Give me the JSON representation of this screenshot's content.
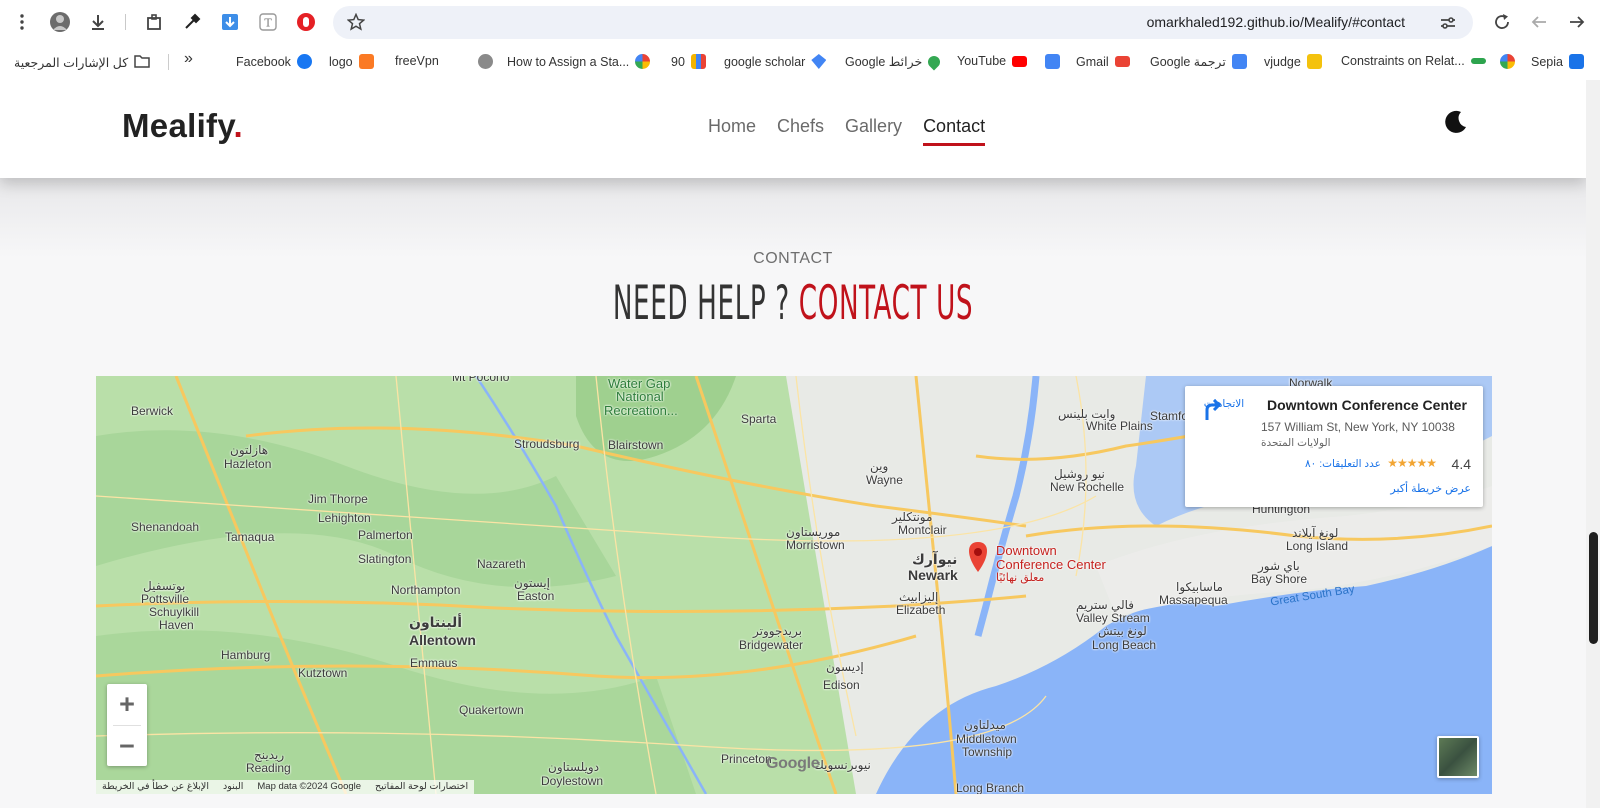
{
  "browser": {
    "url": "omarkhaled192.github.io/Mealify/#contact",
    "bookmarks": [
      {
        "label": "Facebook",
        "icon": "facebook-icon",
        "color": "#1877f2"
      },
      {
        "label": "logo",
        "icon": "xampp-icon",
        "color": "#fb7a24"
      },
      {
        "label": "freeVpn",
        "icon": "",
        "color": ""
      },
      {
        "label": "How to Assign a Sta...",
        "icon": "google-icon",
        "color": "#4285f4"
      },
      {
        "label": "90",
        "icon": "bar-chart-icon",
        "color": "#f4b400"
      },
      {
        "label": "google scholar",
        "icon": "scholar-icon",
        "color": "#4285f4"
      },
      {
        "label": "Google خرائط",
        "icon": "maps-icon",
        "color": "#34a853"
      },
      {
        "label": "YouTube",
        "icon": "youtube-icon",
        "color": "#ff0000"
      },
      {
        "label": "Gmail",
        "icon": "gmail-icon",
        "color": "#ea4335"
      },
      {
        "label": "Google ترجمة",
        "icon": "translate-icon",
        "color": "#4285f4"
      },
      {
        "label": "vjudge",
        "icon": "vjudge-icon",
        "color": "#f4c20d"
      },
      {
        "label": "Constraints on Relat...",
        "icon": "link-icon",
        "color": "#2da44e"
      },
      {
        "label": "Sepia",
        "icon": "code-icon",
        "color": "#1a73e8"
      }
    ],
    "all_bookmarks": "كل الإشارات المرجعية",
    "overflow": "»"
  },
  "site": {
    "logo": "Mealify",
    "logo_dot": ".",
    "nav": [
      "Home",
      "Chefs",
      "Gallery",
      "Contact"
    ],
    "active_nav": "Contact",
    "accent_color": "#c0121b"
  },
  "section": {
    "subtitle": "CONTACT",
    "title_plain": "NEED HELP ? ",
    "title_accent": "CONTACT US"
  },
  "map": {
    "place_name": "Downtown Conference Center",
    "address": "157 William St, New York, NY 10038",
    "country": "الولايات المتحدة",
    "directions_label": "الاتجاهات",
    "rating": "4.4",
    "stars": "★★★★★",
    "reviews": "عدد التعليقات: ٨٠",
    "larger_map": "عرض خريطة أكبر",
    "pin_label": "Downtown Conference Center",
    "pin_sublabel": "معلق نهائيًا",
    "zoom_in": "+",
    "zoom_out": "−",
    "google_logo": "Google",
    "attribution": [
      "الإبلاغ عن خطأ في الخريطة",
      "البنود",
      "Map data ©2024 Google",
      "اختصارات لوحة المفاتيح"
    ],
    "places": [
      {
        "name": "Berwick",
        "cls": ""
      },
      {
        "name": "هازلتون",
        "cls": ""
      },
      {
        "name": "Hazleton",
        "cls": ""
      },
      {
        "name": "Jim Thorpe",
        "cls": ""
      },
      {
        "name": "Lehighton",
        "cls": ""
      },
      {
        "name": "Shenandoah",
        "cls": ""
      },
      {
        "name": "Tamaqua",
        "cls": ""
      },
      {
        "name": "Palmerton",
        "cls": ""
      },
      {
        "name": "Slatington",
        "cls": ""
      },
      {
        "name": "Stroudsburg",
        "cls": ""
      },
      {
        "name": "Blairstown",
        "cls": ""
      },
      {
        "name": "Sparta",
        "cls": ""
      },
      {
        "name": "Mt Pocono",
        "cls": ""
      },
      {
        "name": "Water Gap",
        "cls": "green"
      },
      {
        "name": "National",
        "cls": "green"
      },
      {
        "name": "Recreation...",
        "cls": "green"
      },
      {
        "name": "Nazareth",
        "cls": ""
      },
      {
        "name": "Northampton",
        "cls": ""
      },
      {
        "name": "Easton",
        "cls": ""
      },
      {
        "name": "إيستون",
        "cls": ""
      },
      {
        "name": "بوتسفيل",
        "cls": ""
      },
      {
        "name": "Pottsville",
        "cls": ""
      },
      {
        "name": "Schuylkill",
        "cls": ""
      },
      {
        "name": "Haven",
        "cls": ""
      },
      {
        "name": "ألينتاون",
        "cls": "big"
      },
      {
        "name": "Allentown",
        "cls": "big"
      },
      {
        "name": "Emmaus",
        "cls": ""
      },
      {
        "name": "Hamburg",
        "cls": ""
      },
      {
        "name": "Kutztown",
        "cls": ""
      },
      {
        "name": "Quakertown",
        "cls": ""
      },
      {
        "name": "ريدينج",
        "cls": ""
      },
      {
        "name": "Reading",
        "cls": ""
      },
      {
        "name": "Princeton",
        "cls": ""
      },
      {
        "name": "Doylestown",
        "cls": ""
      },
      {
        "name": "دويلستاون",
        "cls": ""
      },
      {
        "name": "موريستاون",
        "cls": ""
      },
      {
        "name": "Morristown",
        "cls": ""
      },
      {
        "name": "بريدجووتر",
        "cls": ""
      },
      {
        "name": "Bridgewater",
        "cls": ""
      },
      {
        "name": "Edison",
        "cls": ""
      },
      {
        "name": "إديسون",
        "cls": ""
      },
      {
        "name": "نيوبرنسويك",
        "cls": ""
      },
      {
        "name": "وين",
        "cls": ""
      },
      {
        "name": "Wayne",
        "cls": ""
      },
      {
        "name": "مونتكلير",
        "cls": ""
      },
      {
        "name": "Montclair",
        "cls": ""
      },
      {
        "name": "نيوآرك",
        "cls": "big"
      },
      {
        "name": "Newark",
        "cls": "big"
      },
      {
        "name": "إليزابيث",
        "cls": ""
      },
      {
        "name": "Elizabeth",
        "cls": ""
      },
      {
        "name": "White Plains",
        "cls": ""
      },
      {
        "name": "وايت بلينس",
        "cls": ""
      },
      {
        "name": "نيو روشيل",
        "cls": ""
      },
      {
        "name": "New Rochelle",
        "cls": ""
      },
      {
        "name": "Stamford",
        "cls": ""
      },
      {
        "name": "Norwalk",
        "cls": ""
      },
      {
        "name": "Huntington",
        "cls": ""
      },
      {
        "name": "لونغ آيلاند",
        "cls": ""
      },
      {
        "name": "Long Island",
        "cls": ""
      },
      {
        "name": "باي شور",
        "cls": ""
      },
      {
        "name": "Bay Shore",
        "cls": ""
      },
      {
        "name": "ماسابيكوا",
        "cls": ""
      },
      {
        "name": "Massapequa",
        "cls": ""
      },
      {
        "name": "فالي ستريم",
        "cls": ""
      },
      {
        "name": "Valley Stream",
        "cls": ""
      },
      {
        "name": "لونغ بيتش",
        "cls": ""
      },
      {
        "name": "Long Beach",
        "cls": ""
      },
      {
        "name": "Great South Bay",
        "cls": "water"
      },
      {
        "name": "ميدلتاون",
        "cls": ""
      },
      {
        "name": "Middletown",
        "cls": ""
      },
      {
        "name": "Township",
        "cls": ""
      },
      {
        "name": "Long Branch",
        "cls": ""
      }
    ]
  }
}
